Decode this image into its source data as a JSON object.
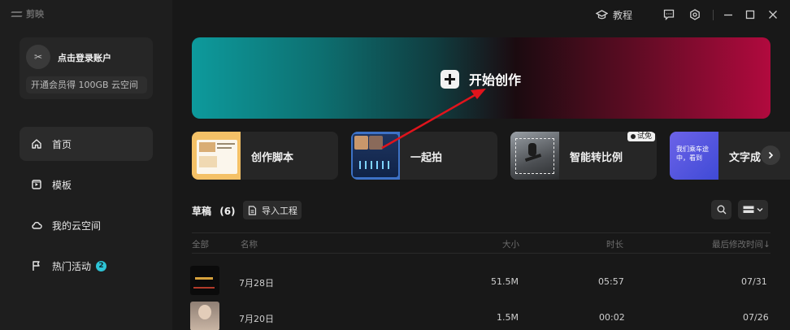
{
  "app": {
    "logo_text": "剪映"
  },
  "account": {
    "avatar_glyph": "✂",
    "login_text": "点击登录账户",
    "vip_text": "开通会员得 100GB 云空间"
  },
  "nav": [
    {
      "label": "首页",
      "icon": "home-icon",
      "active": true
    },
    {
      "label": "模板",
      "icon": "template-icon",
      "active": false
    },
    {
      "label": "我的云空间",
      "icon": "cloud-icon",
      "active": false
    },
    {
      "label": "热门活动",
      "icon": "flag-icon",
      "active": false,
      "badge": "2"
    }
  ],
  "topbar": {
    "tutorial_label": "教程",
    "icons": [
      "graduation-cap-icon",
      "feedback-icon",
      "settings-icon",
      "minimize-icon",
      "maximize-icon",
      "close-icon"
    ]
  },
  "hero": {
    "label": "开始创作"
  },
  "features": [
    {
      "label": "创作脚本",
      "thumb_text": "立体中心\n1字幕"
    },
    {
      "label": "一起拍"
    },
    {
      "label": "智能转比例",
      "tag": "试免"
    },
    {
      "label": "文字成",
      "thumb_text": "我们乘车途\n中，看到"
    }
  ],
  "drafts": {
    "title": "草稿",
    "count": "(6)",
    "import_label": "导入工程"
  },
  "table": {
    "headers": {
      "all": "全部",
      "name": "名称",
      "size": "大小",
      "duration": "时长",
      "modified": "最后修改时间↓"
    },
    "rows": [
      {
        "name": "7月28日",
        "size": "51.5M",
        "duration": "05:57",
        "modified": "07/31"
      },
      {
        "name": "7月20日",
        "size": "1.5M",
        "duration": "00:02",
        "modified": "07/26"
      }
    ]
  },
  "colors": {
    "accent": "#2ec4d6",
    "hero_left": "#0d9a9c",
    "hero_right": "#b10a3e",
    "arrow": "#e0141c"
  }
}
